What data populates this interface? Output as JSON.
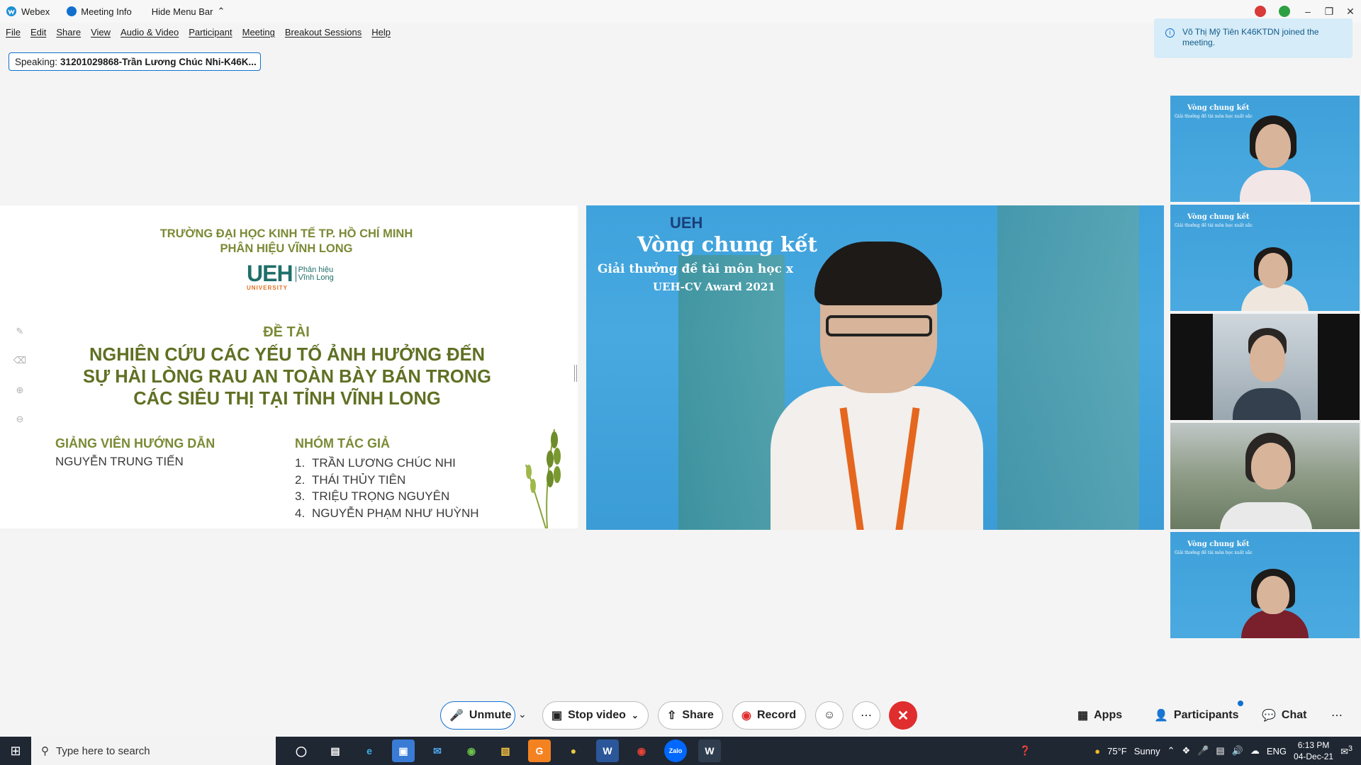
{
  "titlebar": {
    "app_name": "Webex",
    "meeting_info": "Meeting Info",
    "hide_menu": "Hide Menu Bar"
  },
  "menu": [
    "File",
    "Edit",
    "Share",
    "View",
    "Audio & Video",
    "Participant",
    "Meeting",
    "Breakout Sessions",
    "Help"
  ],
  "speaking": {
    "label": "Speaking:",
    "name": "31201029868-Trần Lương Chúc Nhi-K46K..."
  },
  "toast": {
    "message": "Võ Thị Mỹ Tiên K46KTDN joined the meeting."
  },
  "slide": {
    "school_line1": "TRƯỜNG ĐẠI HỌC KINH TẾ TP. HỒ CHÍ MINH",
    "school_line2": "PHÂN HIỆU VĨNH LONG",
    "logo_text": "UEH",
    "logo_univ": "UNIVERSITY",
    "logo_sub1": "Phân hiệu",
    "logo_sub2": "Vĩnh Long",
    "de_tai": "ĐỀ TÀI",
    "topic_line1": "NGHIÊN CỨU CÁC YẾU TỐ ẢNH HƯỞNG ĐẾN",
    "topic_line2": "SỰ HÀI LÒNG RAU AN TOÀN BÀY BÁN TRONG",
    "topic_line3": "CÁC SIÊU THỊ TẠI TỈNH VĨNH LONG",
    "advisor_title": "GIẢNG VIÊN HƯỚNG DẪN",
    "advisor_name": "NGUYỄN TRUNG TIẾN",
    "group_title": "NHÓM TÁC GIẢ",
    "authors": [
      {
        "n": "1.",
        "name": "TRẦN LƯƠNG CHÚC NHI"
      },
      {
        "n": "2.",
        "name": "THÁI THỦY TIÊN"
      },
      {
        "n": "3.",
        "name": "TRIỆU TRỌNG NGUYÊN"
      },
      {
        "n": "4.",
        "name": "NGUYỄN PHẠM NHƯ HUỲNH"
      }
    ]
  },
  "main_video": {
    "logo": "UEH",
    "title": "Vòng chung kết",
    "subtitle": "Giải thưởng đề tài môn học x",
    "award": "UEH-CV Award 2021"
  },
  "thumbs": {
    "title": "Vòng chung kết",
    "subtitle": "Giải thưởng đề tài môn học xuất sắc"
  },
  "controls": {
    "unmute": "Unmute",
    "stop_video": "Stop video",
    "share": "Share",
    "record": "Record",
    "apps": "Apps",
    "participants": "Participants",
    "chat": "Chat"
  },
  "taskbar": {
    "search_placeholder": "Type here to search",
    "weather_temp": "75°F",
    "weather_desc": "Sunny",
    "lang": "ENG",
    "time": "6:13 PM",
    "date": "04-Dec-21",
    "notif_count": "3"
  },
  "colors": {
    "accent": "#1170cf",
    "end_call": "#e02d2d",
    "slide_green": "#7a8a35",
    "taskbar": "#1f2733"
  }
}
